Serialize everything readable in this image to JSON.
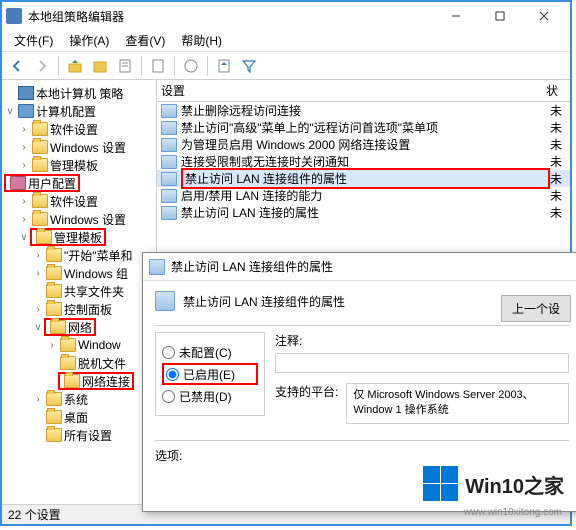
{
  "window": {
    "title": "本地组策略编辑器",
    "minimize": "—",
    "maximize": "□",
    "close": "×"
  },
  "menu": {
    "file": "文件(F)",
    "action": "操作(A)",
    "view": "查看(V)",
    "help": "帮助(H)"
  },
  "tree": {
    "root": "本地计算机 策略",
    "comp_cfg": "计算机配置",
    "soft_set": "软件设置",
    "win_set": "Windows 设置",
    "admin_tpl": "管理模板",
    "user_cfg": "用户配置",
    "soft_set2": "软件设置",
    "win_set2": "Windows 设置",
    "admin_tpl2": "管理模板",
    "start_menu": "\"开始\"菜单和",
    "win_comp": "Windows 组",
    "share_fold": "共享文件夹",
    "ctrl_panel": "控制面板",
    "network": "网络",
    "window": "Window",
    "offline": "脱机文件",
    "netconn": "网络连接",
    "system": "系统",
    "desktop": "桌面",
    "all_set": "所有设置"
  },
  "list": {
    "header_setting": "设置",
    "header_state_short": "状",
    "items": [
      {
        "t": "禁止删除远程访问连接",
        "s": "未"
      },
      {
        "t": "禁止访问\"高级\"菜单上的\"远程访问首选项\"菜单项",
        "s": "未"
      },
      {
        "t": "为管理员启用 Windows 2000 网络连接设置",
        "s": "未"
      },
      {
        "t": "连接受限制或无连接时关闭通知",
        "s": "未"
      },
      {
        "t": "禁止访问 LAN 连接组件的属性",
        "s": "未",
        "sel": true
      },
      {
        "t": "启用/禁用 LAN 连接的能力",
        "s": "未"
      },
      {
        "t": "禁止访问 LAN 连接的属性",
        "s": "未"
      }
    ]
  },
  "dialog": {
    "title": "禁止访问 LAN 连接组件的属性",
    "heading": "禁止访问 LAN 连接组件的属性",
    "prev_btn": "上一个设",
    "r_notconf": "未配置(C)",
    "r_enabled": "已启用(E)",
    "r_disabled": "已禁用(D)",
    "comment": "注释:",
    "platform": "支持的平台:",
    "platform_val": "仅 Microsoft Windows Server 2003、Window 1 操作系统",
    "options": "选项:"
  },
  "status": {
    "count": "22 个设置"
  },
  "watermark": {
    "text": "Win10之家",
    "url": "www.win10xitong.com"
  }
}
